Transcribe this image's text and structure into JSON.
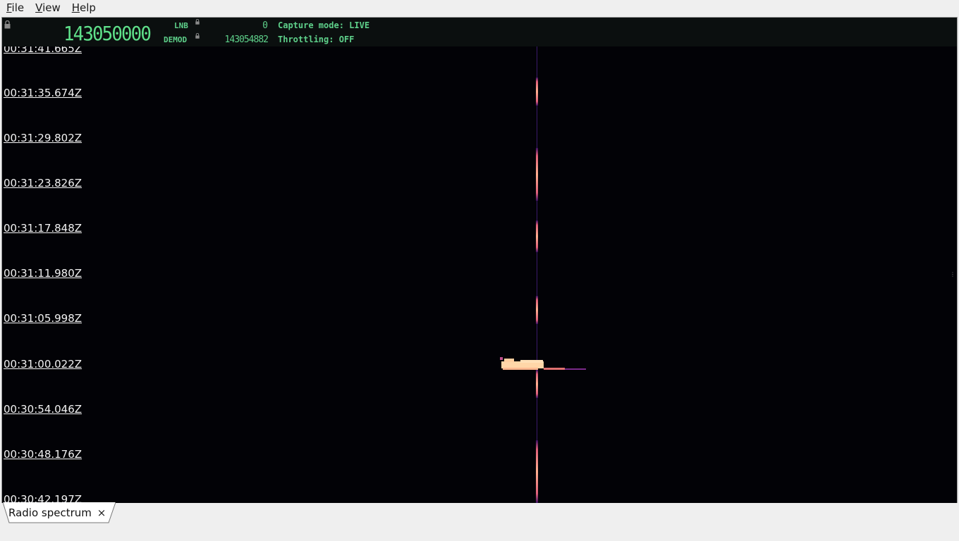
{
  "menu": {
    "file": {
      "mnemonic": "F",
      "rest": "ile"
    },
    "view": {
      "mnemonic": "V",
      "rest": "iew"
    },
    "help": {
      "mnemonic": "H",
      "rest": "elp"
    }
  },
  "status": {
    "frequency": "143050000",
    "lnb_label": "LNB",
    "lnb_value": "0",
    "demod_label": "DEMOD",
    "demod_value": "143054882",
    "capture_mode": "Capture mode: LIVE",
    "throttling": "Throttling: OFF",
    "text_color": "#5ed08a"
  },
  "waterfall": {
    "timestamps": [
      "00:31:41.665Z",
      "00:31:35.674Z",
      "00:31:29.802Z",
      "00:31:23.826Z",
      "00:31:17.848Z",
      "00:31:11.980Z",
      "00:31:05.998Z",
      "00:31:00.022Z",
      "00:30:54.046Z",
      "00:30:48.176Z",
      "00:30:42.197Z"
    ],
    "carrier_color": "#ff8a70",
    "burst_color": "#ffd6a8"
  },
  "tabs": [
    {
      "label": "Radio spectrum",
      "close": "×"
    }
  ]
}
